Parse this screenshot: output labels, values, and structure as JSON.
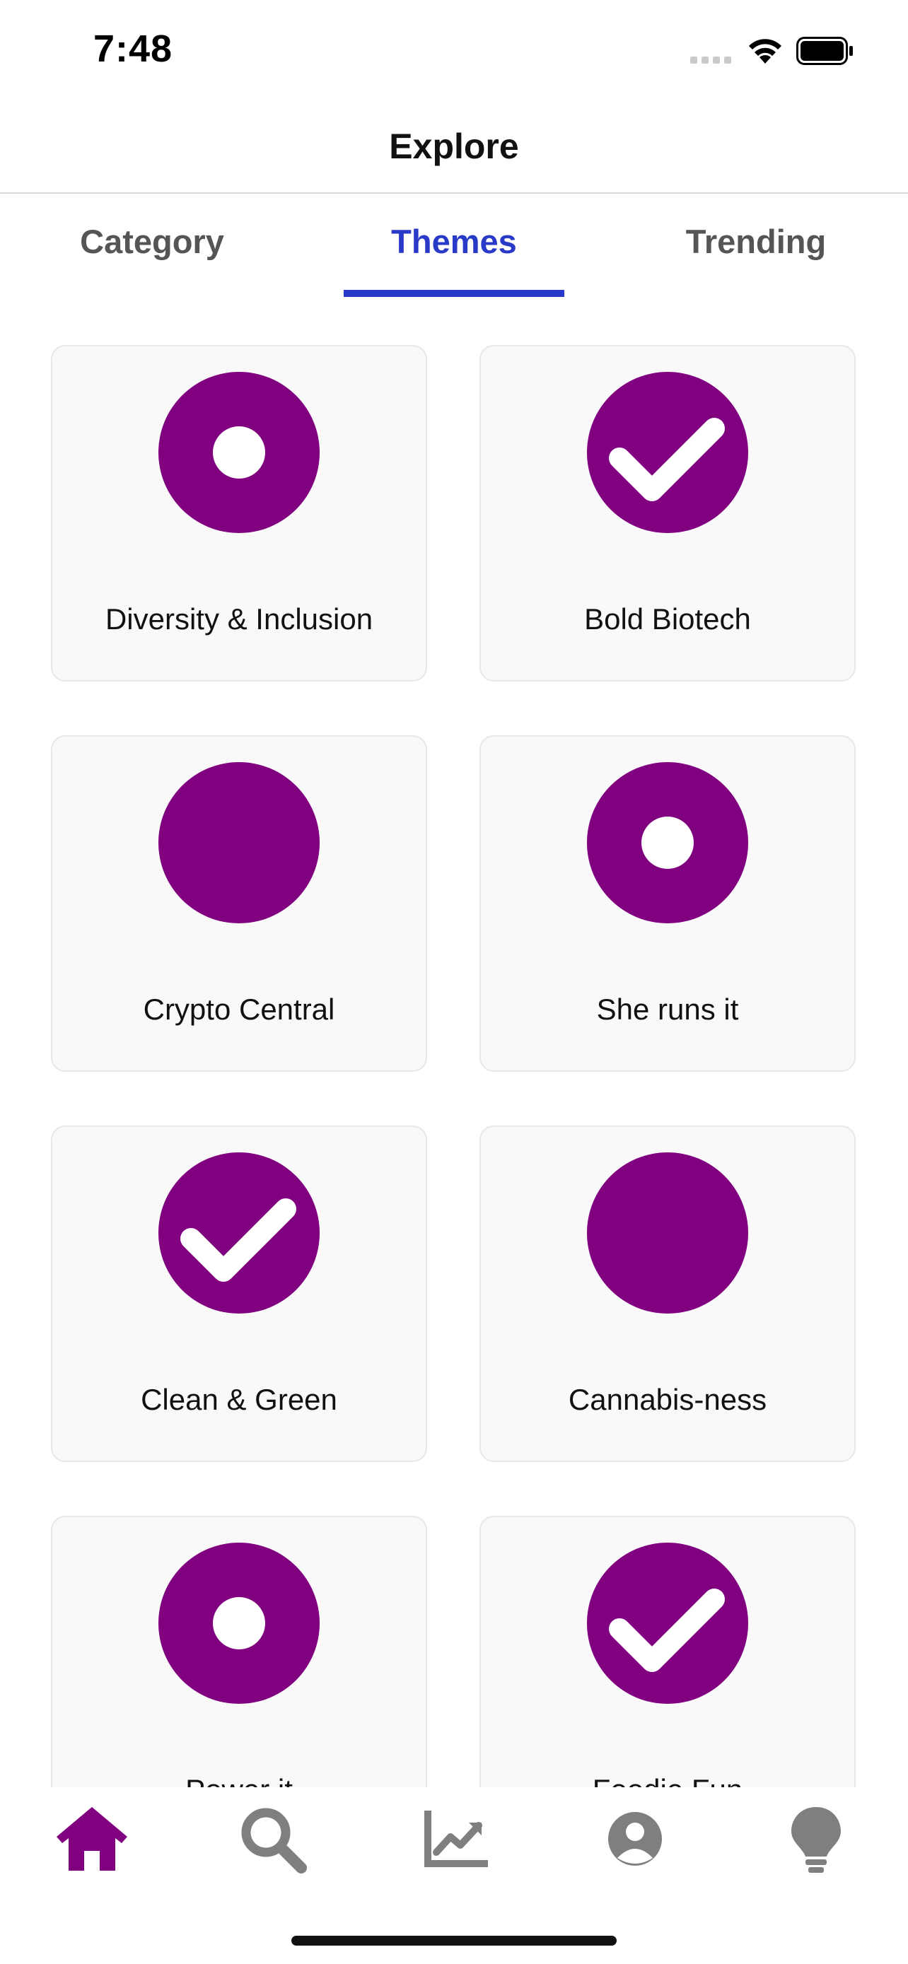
{
  "status_bar": {
    "time": "7:48",
    "icons": [
      "signal-icon",
      "wifi-icon",
      "battery-icon"
    ]
  },
  "header": {
    "title": "Explore"
  },
  "tabs": [
    {
      "label": "Category",
      "active": false
    },
    {
      "label": "Themes",
      "active": true
    },
    {
      "label": "Trending",
      "active": false
    }
  ],
  "themes": [
    {
      "label": "Diversity & Inclusion",
      "icon": "ring-icon"
    },
    {
      "label": "Bold Biotech",
      "icon": "check-circle-icon"
    },
    {
      "label": "Crypto Central",
      "icon": "filled-circle-icon"
    },
    {
      "label": "She runs it",
      "icon": "ring-icon"
    },
    {
      "label": "Clean & Green",
      "icon": "check-circle-icon"
    },
    {
      "label": "Cannabis-ness",
      "icon": "filled-circle-icon"
    },
    {
      "label": "Power it",
      "icon": "ring-icon"
    },
    {
      "label": "Foodie Fun",
      "icon": "check-circle-icon"
    }
  ],
  "bottom_nav": [
    {
      "name": "home-icon",
      "active": true
    },
    {
      "name": "search-icon",
      "active": false
    },
    {
      "name": "chart-icon",
      "active": false
    },
    {
      "name": "profile-icon",
      "active": false
    },
    {
      "name": "lightbulb-icon",
      "active": false
    }
  ],
  "colors": {
    "accent": "#2a3ac8",
    "theme_icon": "#800080",
    "nav_active": "#800080",
    "nav_inactive": "#7f7f7f"
  }
}
